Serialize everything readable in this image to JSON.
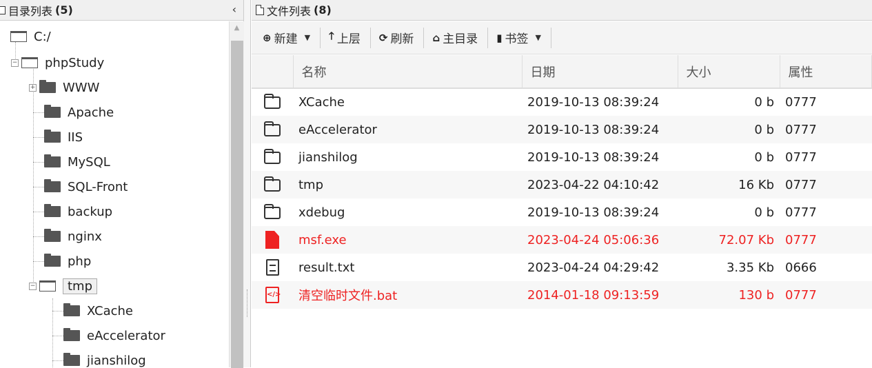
{
  "tree_panel": {
    "title": "目录列表",
    "count": "(5)",
    "collapse_label": "‹",
    "nodes": [
      {
        "label": "C:/",
        "icon": "folder-open-icon"
      },
      {
        "label": "phpStudy",
        "icon": "folder-open-icon"
      },
      {
        "label": "WWW",
        "icon": "folder-closed-icon"
      },
      {
        "label": "Apache",
        "icon": "folder-closed-icon"
      },
      {
        "label": "IIS",
        "icon": "folder-closed-icon"
      },
      {
        "label": "MySQL",
        "icon": "folder-closed-icon"
      },
      {
        "label": "SQL-Front",
        "icon": "folder-closed-icon"
      },
      {
        "label": "backup",
        "icon": "folder-closed-icon"
      },
      {
        "label": "nginx",
        "icon": "folder-closed-icon"
      },
      {
        "label": "php",
        "icon": "folder-closed-icon"
      },
      {
        "label": "tmp",
        "icon": "folder-open-icon",
        "selected": true
      },
      {
        "label": "XCache",
        "icon": "folder-closed-icon"
      },
      {
        "label": "eAccelerator",
        "icon": "folder-closed-icon"
      },
      {
        "label": "jianshilog",
        "icon": "folder-closed-icon"
      }
    ]
  },
  "file_panel": {
    "title": "文件列表",
    "count": "(8)"
  },
  "toolbar": {
    "new_label": "新建",
    "up_label": "上层",
    "refresh_label": "刷新",
    "home_label": "主目录",
    "bookmark_label": "书签"
  },
  "table": {
    "columns": [
      "名称",
      "日期",
      "大小",
      "属性"
    ],
    "rows": [
      {
        "name": "XCache",
        "date": "2019-10-13 08:39:24",
        "size": "0 b",
        "attr": "0777",
        "icon": "folder-icon"
      },
      {
        "name": "eAccelerator",
        "date": "2019-10-13 08:39:24",
        "size": "0 b",
        "attr": "0777",
        "icon": "folder-icon"
      },
      {
        "name": "jianshilog",
        "date": "2019-10-13 08:39:24",
        "size": "0 b",
        "attr": "0777",
        "icon": "folder-icon"
      },
      {
        "name": "tmp",
        "date": "2023-04-22 04:10:42",
        "size": "16 Kb",
        "attr": "0777",
        "icon": "folder-icon"
      },
      {
        "name": "xdebug",
        "date": "2019-10-13 08:39:24",
        "size": "0 b",
        "attr": "0777",
        "icon": "folder-icon"
      },
      {
        "name": "msf.exe",
        "date": "2023-04-24 05:06:36",
        "size": "72.07 Kb",
        "attr": "0777",
        "icon": "exe-file-icon",
        "highlight": true
      },
      {
        "name": "result.txt",
        "date": "2023-04-24 04:29:42",
        "size": "3.35 Kb",
        "attr": "0666",
        "icon": "text-file-icon"
      },
      {
        "name": "清空临时文件.bat",
        "date": "2014-01-18 09:13:59",
        "size": "130 b",
        "attr": "0777",
        "icon": "code-file-icon",
        "highlight": true
      }
    ]
  },
  "colors": {
    "danger": "#ee2222",
    "header_bg": "#f0f0f0"
  }
}
